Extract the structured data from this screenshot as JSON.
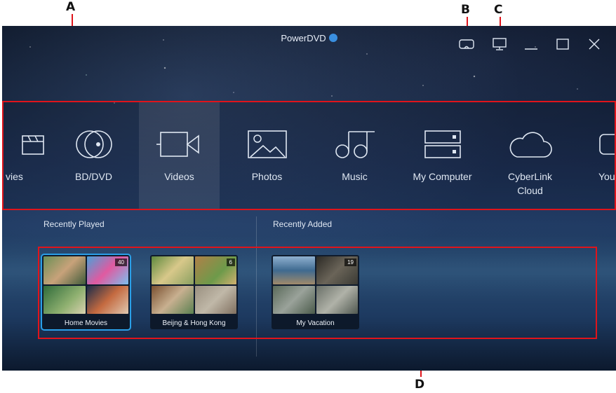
{
  "callouts": {
    "a": "A",
    "b": "B",
    "c": "C",
    "d": "D"
  },
  "app": {
    "title": "PowerDVD"
  },
  "window_controls": {
    "vr_icon": "vr-mode-icon",
    "tv_icon": "tv-mode-icon"
  },
  "nav": {
    "items": [
      {
        "label": "vies",
        "icon": "clapperboard-icon"
      },
      {
        "label": "BD/DVD",
        "icon": "disc-icon"
      },
      {
        "label": "Videos",
        "icon": "video-camera-icon",
        "active": true
      },
      {
        "label": "Photos",
        "icon": "photo-icon"
      },
      {
        "label": "Music",
        "icon": "music-note-icon"
      },
      {
        "label": "My Computer",
        "icon": "computer-drive-icon"
      },
      {
        "label": "CyberLink Cloud",
        "icon": "cloud-icon"
      },
      {
        "label": "You",
        "icon": "youtube-icon"
      }
    ]
  },
  "sections": {
    "recently_played": "Recently Played",
    "recently_added": "Recently Added"
  },
  "albums": [
    {
      "title": "Home Movies",
      "count": "40",
      "selected": true
    },
    {
      "title": "Beijng & Hong Kong",
      "count": "6"
    },
    {
      "title": "My Vacation",
      "count": "19"
    }
  ],
  "colors": {
    "annotation": "#e0141b",
    "selection": "#2a9fe8"
  }
}
